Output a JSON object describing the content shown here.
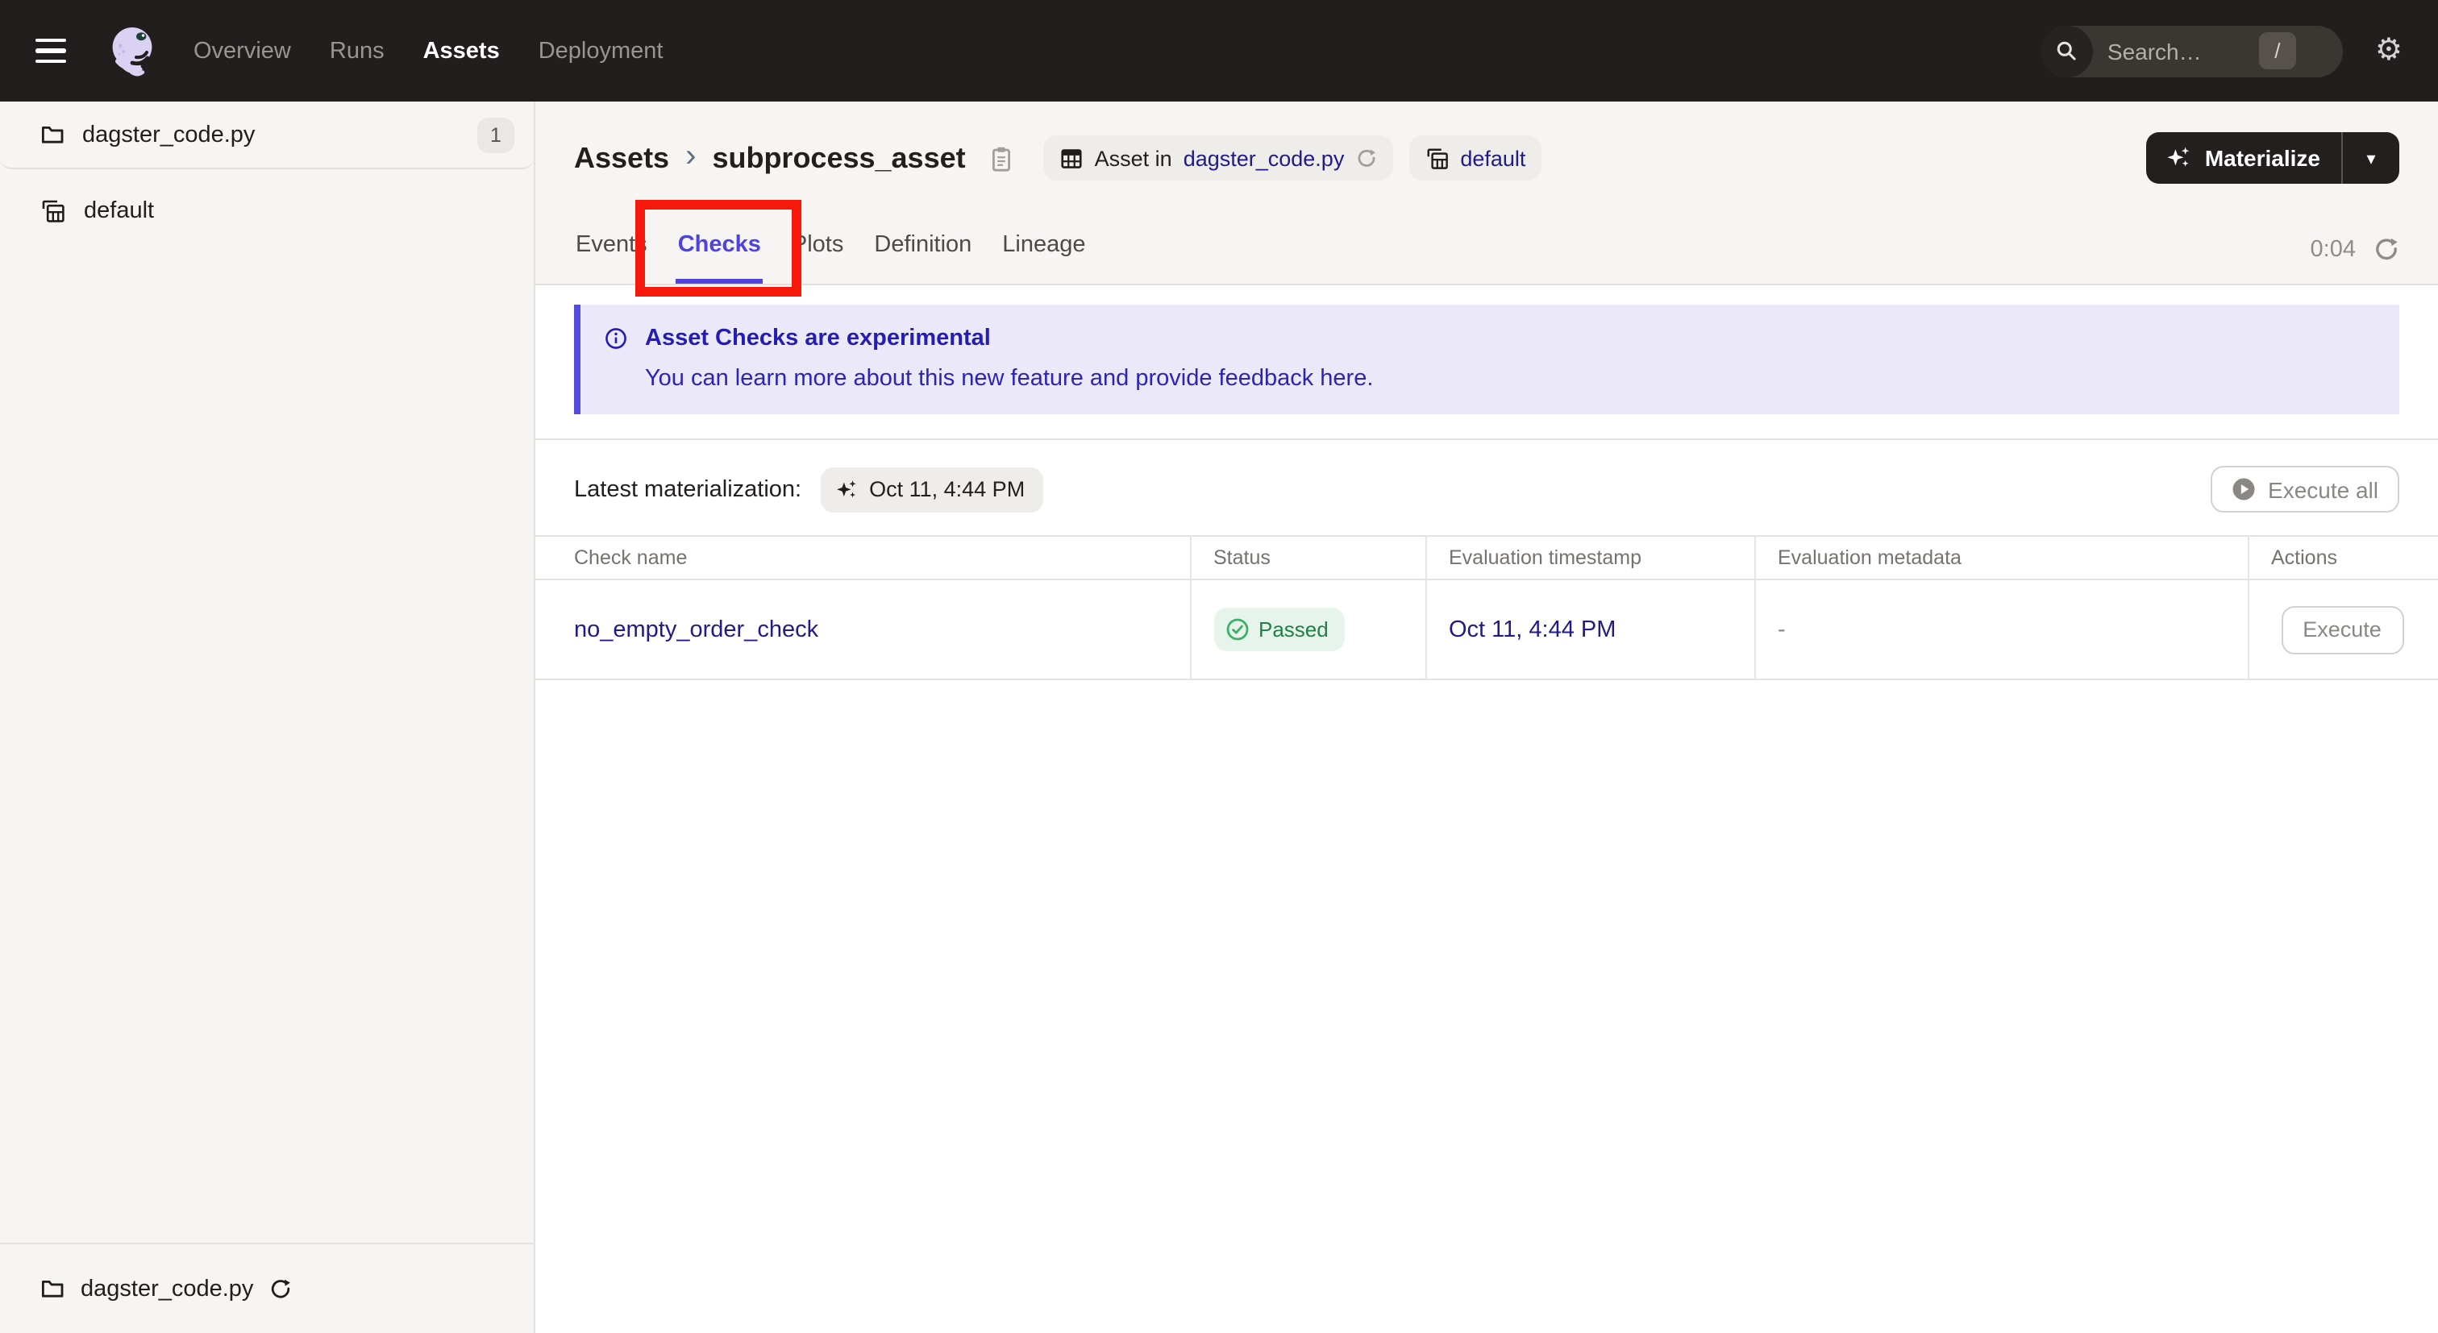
{
  "topnav": {
    "items": [
      {
        "label": "Overview",
        "active": false
      },
      {
        "label": "Runs",
        "active": false
      },
      {
        "label": "Assets",
        "active": true
      },
      {
        "label": "Deployment",
        "active": false
      }
    ],
    "search": {
      "placeholder": "Search…",
      "shortcut": "/"
    }
  },
  "sidebar": {
    "groups_item": {
      "label": "dagster_code.py",
      "count": "1"
    },
    "default_item": {
      "label": "default"
    },
    "bottom_item": {
      "label": "dagster_code.py"
    }
  },
  "header": {
    "breadcrumb": {
      "root": "Assets",
      "current": "subprocess_asset"
    },
    "asset_badge": {
      "prefix": "Asset in",
      "link": "dagster_code.py"
    },
    "group_badge": {
      "label": "default"
    },
    "materialize": {
      "label": "Materialize"
    }
  },
  "tabs": {
    "items": [
      {
        "label": "Events",
        "active": false
      },
      {
        "label": "Checks",
        "active": true
      },
      {
        "label": "Plots",
        "active": false
      },
      {
        "label": "Definition",
        "active": false
      },
      {
        "label": "Lineage",
        "active": false
      }
    ],
    "timer": "0:04"
  },
  "banner": {
    "title": "Asset Checks are experimental",
    "body": "You can learn more about this new feature and provide feedback ",
    "link": "here",
    "suffix": "."
  },
  "materialization": {
    "label": "Latest materialization:",
    "timestamp": "Oct 11, 4:44 PM",
    "execute_all": "Execute all"
  },
  "checks_table": {
    "columns": [
      "Check name",
      "Status",
      "Evaluation timestamp",
      "Evaluation metadata",
      "Actions"
    ],
    "rows": [
      {
        "name": "no_empty_order_check",
        "status": "Passed",
        "timestamp": "Oct 11, 4:44 PM",
        "metadata": "-",
        "action": "Execute"
      }
    ]
  },
  "colors": {
    "topnav_bg": "#221e1d",
    "accent": "#4f43dd",
    "link": "#201b86",
    "banner_bg": "#ebe9f9",
    "banner_text": "#241db3",
    "success_bg": "#e7f4eb",
    "success_text": "#1f8048",
    "annotation_red": "#f6190b",
    "surface": "#f6f5f3",
    "border": "#e5e2de"
  }
}
